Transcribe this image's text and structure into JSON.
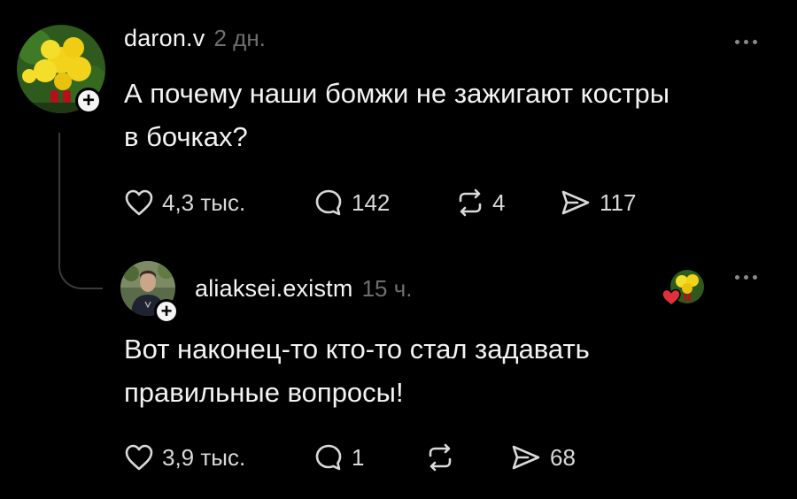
{
  "post": {
    "username": "daron.v",
    "time": "2 дн.",
    "text_line1": "А почему наши бомжи не зажигают костры",
    "text_line2": "в бочках?",
    "likes": "4,3 тыс.",
    "comments": "142",
    "reposts": "4",
    "shares": "117"
  },
  "reply": {
    "username": "aliaksei.existm",
    "time": "15 ч.",
    "text_line1": "Вот наконец-то кто-то стал задавать",
    "text_line2": "правильные вопросы!",
    "likes": "3,9 тыс.",
    "comments": "1",
    "reposts": "",
    "shares": "68"
  },
  "icons": {
    "like": "heart-outline-icon",
    "comment": "speech-bubble-icon",
    "repost": "repost-arrows-icon",
    "share": "send-icon",
    "more": "more-dots-icon",
    "follow": "plus-icon",
    "liked_by_author": "heart-filled-icon"
  },
  "colors": {
    "background": "#000000",
    "text": "#f3f3f3",
    "muted": "#6e6e6e",
    "liked_heart": "#e0303a"
  }
}
